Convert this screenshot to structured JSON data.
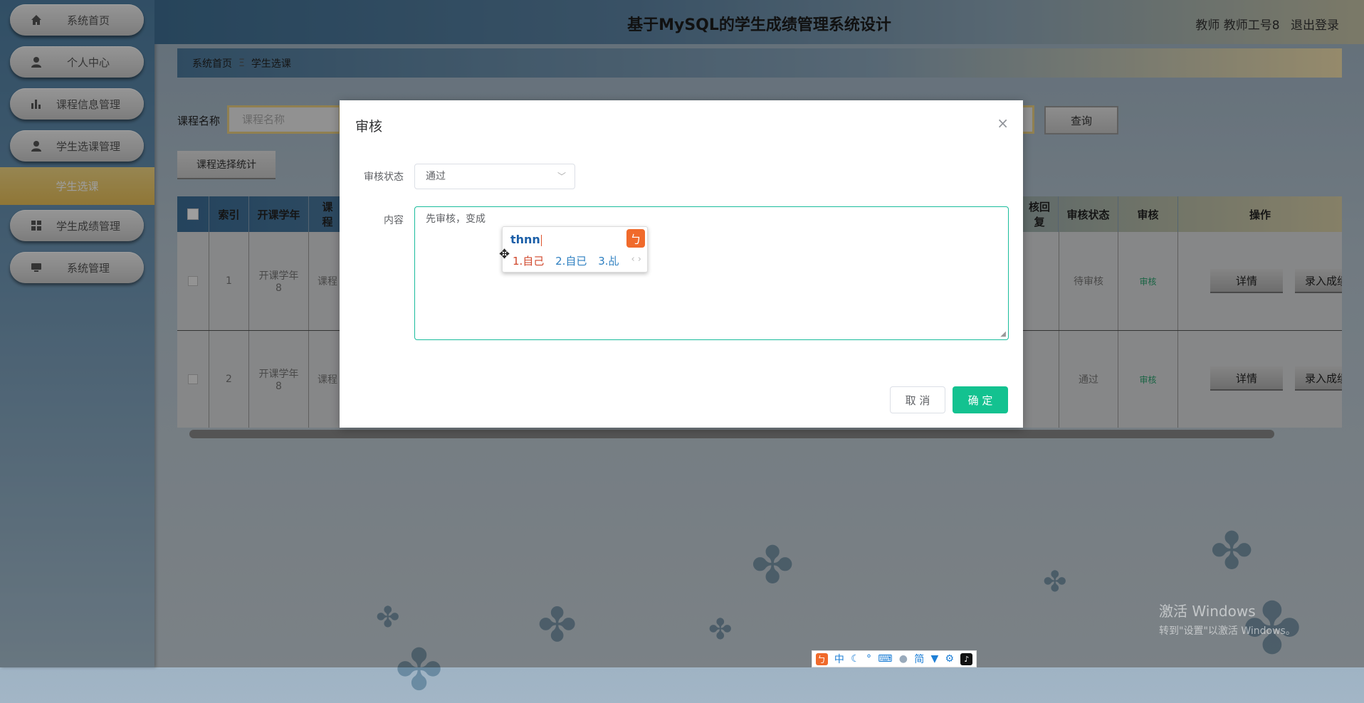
{
  "app": {
    "title": "基于MySQL的学生成绩管理系统设计",
    "user_role": "教师 教师工号8",
    "logout": "退出登录"
  },
  "sidebar": {
    "items": [
      {
        "label": "系统首页",
        "icon": "home-icon"
      },
      {
        "label": "个人中心",
        "icon": "user-icon"
      },
      {
        "label": "课程信息管理",
        "icon": "bar-chart-icon"
      },
      {
        "label": "学生选课管理",
        "icon": "user-icon"
      },
      {
        "label": "学生成绩管理",
        "icon": "grid-icon"
      },
      {
        "label": "系统管理",
        "icon": "monitor-icon"
      }
    ],
    "sub_item": "学生选课"
  },
  "breadcrumb": {
    "home": "系统首页",
    "separator": "Ξ",
    "current": "学生选课"
  },
  "search": {
    "label": "课程名称",
    "placeholder": "课程名称",
    "query_button": "查询"
  },
  "stats_button": "课程选择统计",
  "table": {
    "headers": {
      "index": "索引",
      "year": "开课学年",
      "course_frag": "课程",
      "reply_frag": "核回复",
      "status": "审核状态",
      "audit": "审核",
      "actions": "操作"
    },
    "rows": [
      {
        "index": "1",
        "year": "开课学年8",
        "course_frag": "课程",
        "status": "待审核",
        "audit": "审核",
        "detail": "详情",
        "enter": "录入成绩"
      },
      {
        "index": "2",
        "year": "开课学年8",
        "course_frag": "课程",
        "status": "通过",
        "audit": "审核",
        "detail": "详情",
        "enter": "录入成绩"
      }
    ]
  },
  "modal": {
    "title": "审核",
    "close": "×",
    "status_label": "审核状态",
    "status_value": "通过",
    "content_label": "内容",
    "content_value": "先审核，变成",
    "cancel": "取 消",
    "confirm": "确 定"
  },
  "ime": {
    "composition": "thnn",
    "candidates": [
      "1.自己",
      "2.自已",
      "3.乩"
    ],
    "nav": "‹ ›",
    "toolbar": [
      "中",
      "☾",
      "°",
      "⌨",
      "简"
    ]
  },
  "watermark": {
    "line1": "激活 Windows",
    "line2": "转到\"设置\"以激活 Windows。"
  },
  "colors": {
    "accent": "#13c290",
    "brand_orange": "#f06a2b",
    "sidebar_active": "#e8bf58"
  }
}
